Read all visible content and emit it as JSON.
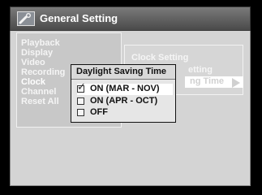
{
  "header": {
    "title": "General Setting",
    "icon": "tool-icon"
  },
  "menu": {
    "items": [
      {
        "label": "Playback",
        "state": "normal"
      },
      {
        "label": "Display",
        "state": "normal"
      },
      {
        "label": "Video",
        "state": "normal"
      },
      {
        "label": "Recording",
        "state": "normal"
      },
      {
        "label": "Clock",
        "state": "active"
      },
      {
        "label": "Channel",
        "state": "normal"
      },
      {
        "label": "Reset All",
        "state": "normal"
      }
    ]
  },
  "submenu": {
    "items": [
      {
        "label": "Clock Setting"
      },
      {
        "label": "etting"
      },
      {
        "label": "ng Time"
      }
    ]
  },
  "popup": {
    "title": "Daylight Saving Time",
    "options": [
      {
        "label": "ON (MAR - NOV)",
        "checked": true
      },
      {
        "label": "ON (APR - OCT)",
        "checked": false
      },
      {
        "label": "OFF",
        "checked": false
      }
    ]
  }
}
